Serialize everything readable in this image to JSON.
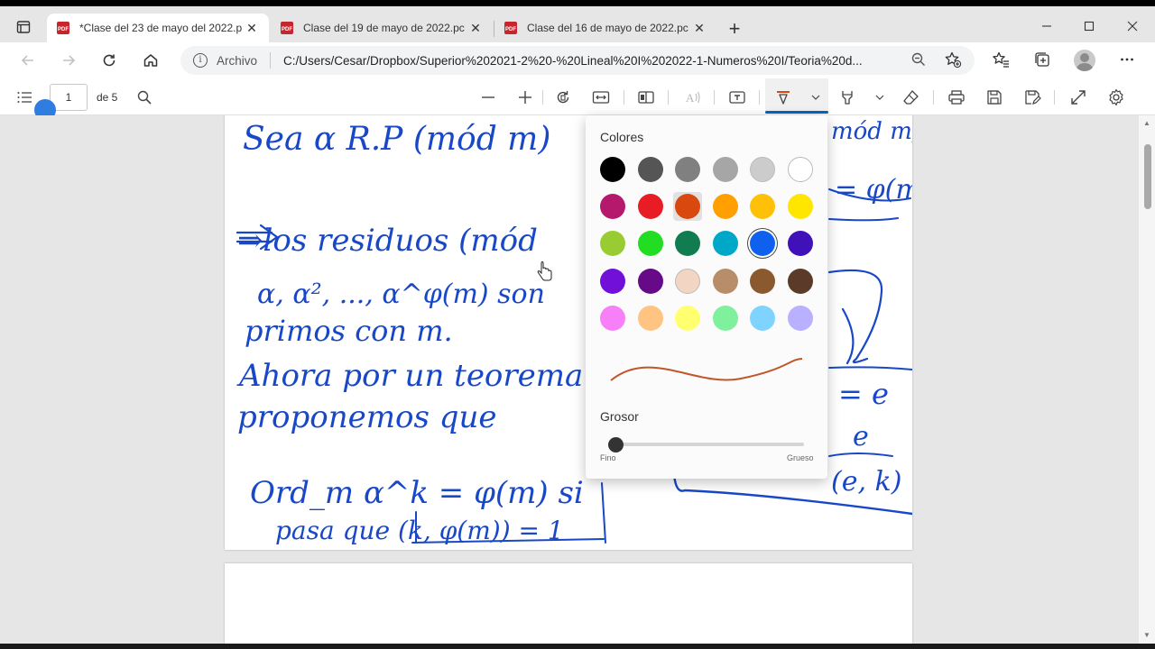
{
  "tabs": [
    {
      "title": "*Clase del 23 de mayo del 2022.p",
      "active": true
    },
    {
      "title": "Clase del 19 de mayo de 2022.pc",
      "active": false
    },
    {
      "title": "Clase del 16 de mayo de 2022.pc",
      "active": false
    }
  ],
  "address": {
    "scheme_label": "Archivo",
    "url": "C:/Users/Cesar/Dropbox/Superior%202021-2%20-%20Lineal%20I%202022-1-Numeros%20I/Teoria%20d..."
  },
  "pdf_toolbar": {
    "page_number": "1",
    "page_of": "de 5"
  },
  "ink_panel": {
    "colors_heading": "Colores",
    "thickness_heading": "Grosor",
    "thin_label": "Fino",
    "thick_label": "Grueso",
    "swatches": [
      [
        "#000000",
        "#555555",
        "#808080",
        "#a6a6a6",
        "#cccccc",
        "#ffffff"
      ],
      [
        "#b5196b",
        "#e81c24",
        "#d9480f",
        "#ffa000",
        "#ffc107",
        "#ffe600"
      ],
      [
        "#99cc33",
        "#22dd22",
        "#107c50",
        "#00a8c8",
        "#1060f0",
        "#4010b8"
      ],
      [
        "#7010d8",
        "#660a88",
        "#f2d5c3",
        "#b88d6a",
        "#8a5a2e",
        "#5c3a2a"
      ],
      [
        "#f77ff7",
        "#ffc481",
        "#ffff70",
        "#7ff09b",
        "#7fd4ff",
        "#b9b0ff"
      ]
    ],
    "selected_swatch": "#1060f0",
    "framed_swatch": "#d9480f",
    "preview_stroke_color": "#c0562a",
    "thickness_value": 0.0
  },
  "handwriting": {
    "ink_color": "#1848c8",
    "lines": [
      "Sea α R.P (mód m)",
      "⇒los residuos (mód",
      "α, α², ..., α^φ(m) son",
      "primos con m.",
      "Ahora por un teorema",
      "proponemos que",
      "Ord_m α^k = φ(m) si",
      "pasa que (k, φ(m)) = 1"
    ],
    "right_lines": [
      "mód m)",
      "= φ(m",
      "= e",
      "e",
      "(e, k)"
    ]
  }
}
